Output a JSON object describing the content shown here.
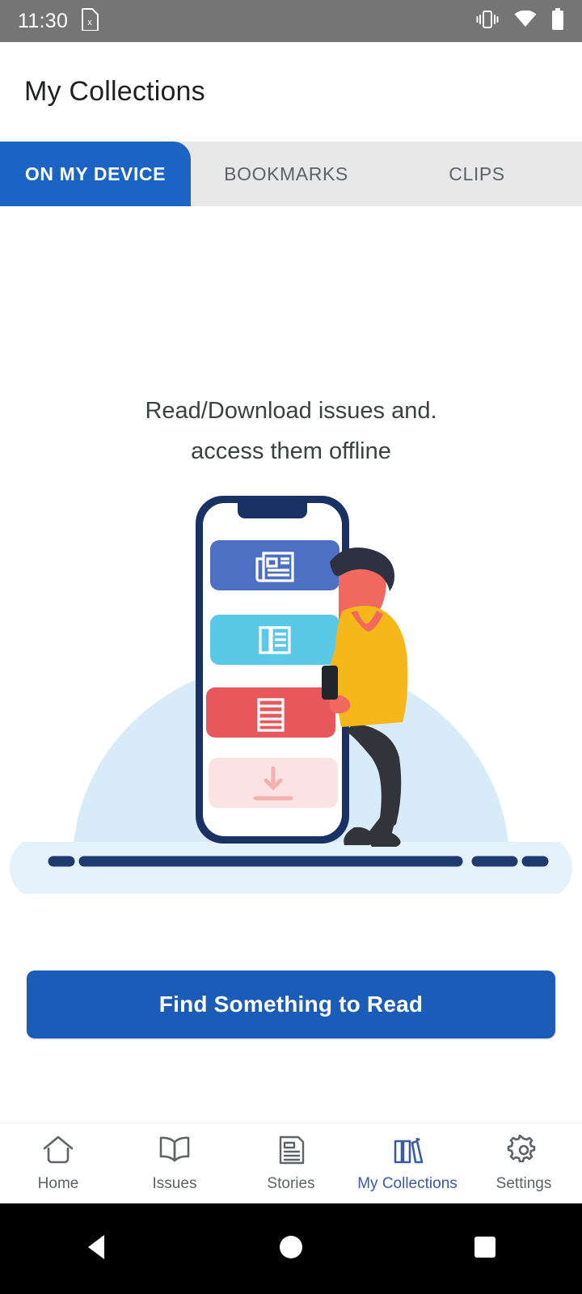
{
  "status_bar": {
    "time": "11:30",
    "icons": [
      "sim-card-x-icon",
      "vibrate-icon",
      "wifi-icon",
      "battery-icon"
    ],
    "background": "#757575"
  },
  "header": {
    "title": "My Collections"
  },
  "tabs": {
    "active_index": 0,
    "active_color": "#1b63c4",
    "bar_background": "#e8e8e8",
    "items": [
      {
        "label": "ON MY DEVICE"
      },
      {
        "label": "BOOKMARKS"
      },
      {
        "label": "CLIPS"
      }
    ]
  },
  "empty_state": {
    "line1": "Read/Download issues and.",
    "line2": "access them offline",
    "illustration": {
      "name": "offline-reading-illustration",
      "wifi_off_icon": "wifi-off-icon",
      "wifi_off_color": "#4a8fd4",
      "backdrop_color": "#d8ebf8",
      "base_color": "#e6f2fb",
      "ground_color": "#1e3a6e",
      "phone_frame_color": "#1a3263",
      "cards": [
        {
          "name": "newspaper-card",
          "color": "#4d6fc4",
          "icon": "newspaper-icon"
        },
        {
          "name": "magazine-card",
          "color": "#5bc8e8",
          "icon": "magazine-icon"
        },
        {
          "name": "article-card",
          "color": "#e8575c",
          "icon": "list-article-icon"
        },
        {
          "name": "download-card",
          "color": "#fbe3e3",
          "icon": "download-arrow-icon"
        }
      ],
      "person": {
        "hair_color": "#2d3142",
        "skin_color": "#f0685e",
        "sweater_color": "#f5b71a",
        "pants_color": "#33333a",
        "phone_color": "#24242c"
      }
    }
  },
  "cta": {
    "label": "Find Something to Read",
    "color": "#1b5cb8"
  },
  "bottom_nav": {
    "active_index": 3,
    "active_color": "#3b5ba5",
    "inactive_color": "#5f6368",
    "items": [
      {
        "label": "Home",
        "icon": "home-icon"
      },
      {
        "label": "Issues",
        "icon": "book-icon"
      },
      {
        "label": "Stories",
        "icon": "article-icon"
      },
      {
        "label": "My Collections",
        "icon": "books-icon"
      },
      {
        "label": "Settings",
        "icon": "gear-icon"
      }
    ]
  },
  "android_nav": {
    "items": [
      {
        "name": "back-button",
        "icon": "triangle-back-icon"
      },
      {
        "name": "home-button",
        "icon": "circle-home-icon"
      },
      {
        "name": "recents-button",
        "icon": "square-recents-icon"
      }
    ]
  }
}
